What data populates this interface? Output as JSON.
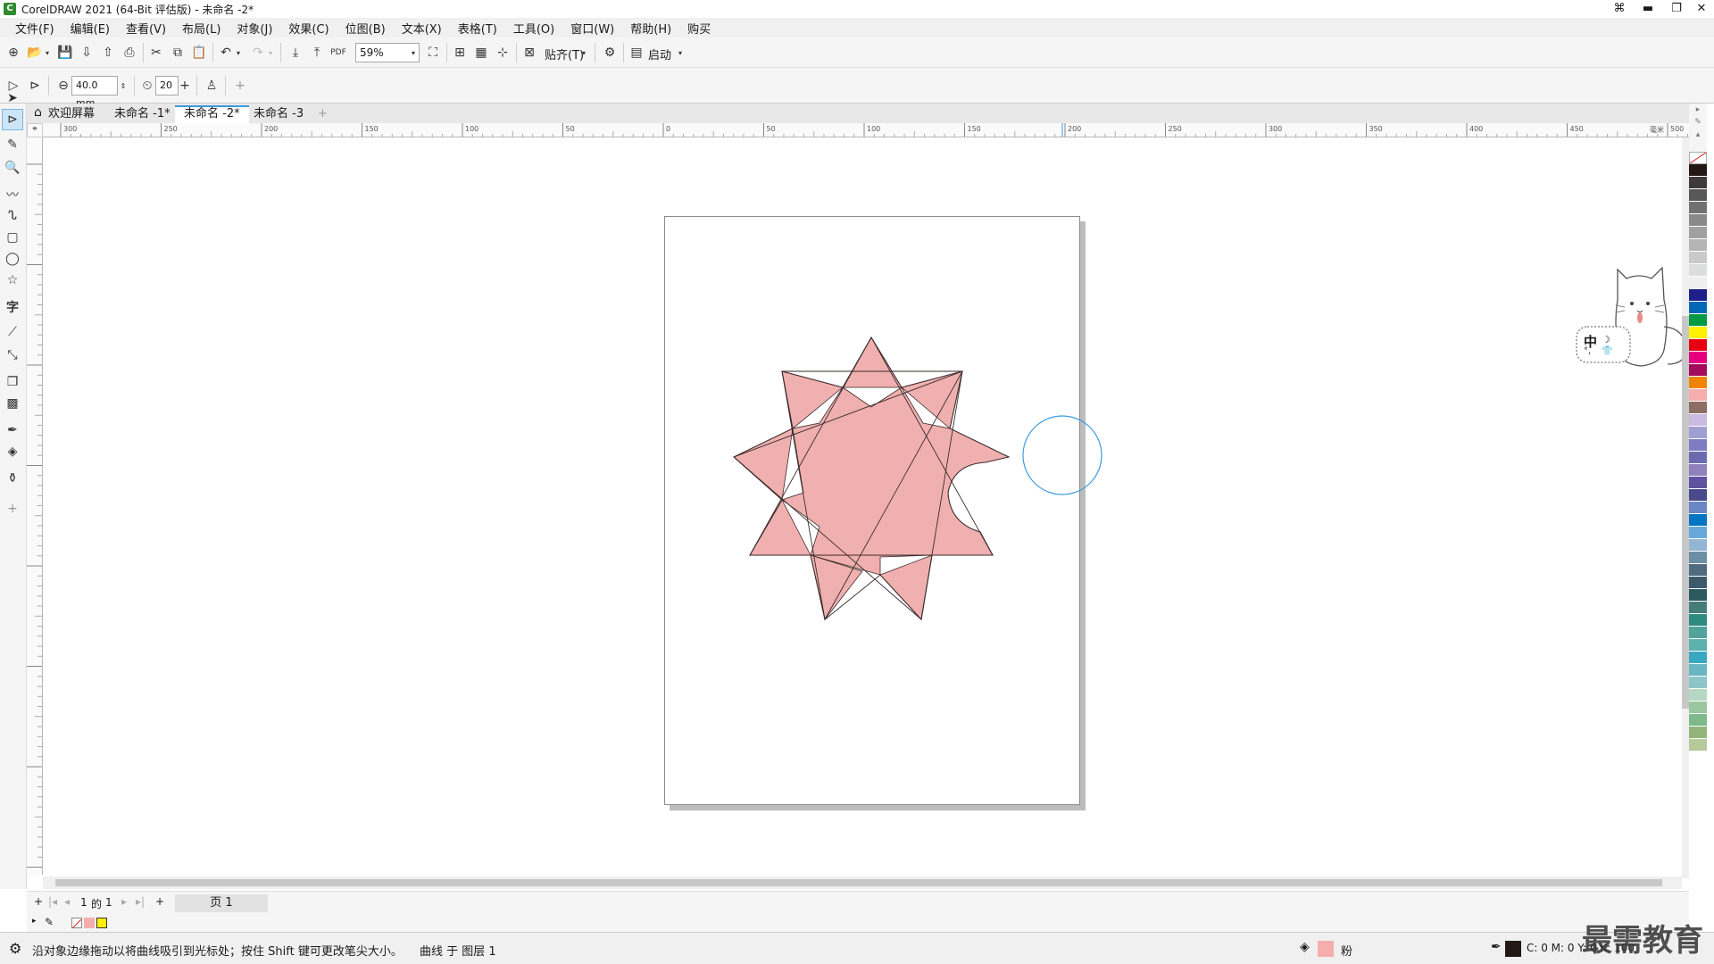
{
  "window": {
    "title": "CorelDRAW 2021 (64-Bit 评估版) - 未命名 -2*",
    "controls": [
      "▬",
      "❐",
      "✕"
    ]
  },
  "menu": [
    "文件(F)",
    "编辑(E)",
    "查看(V)",
    "布局(L)",
    "对象(J)",
    "效果(C)",
    "位图(B)",
    "文本(X)",
    "表格(T)",
    "工具(O)",
    "窗口(W)",
    "帮助(H)",
    "购买"
  ],
  "toolbar": {
    "zoom": "59%",
    "snap_label": "贴齐(T)",
    "launch_label": "启动"
  },
  "property_bar": {
    "nib_size": "40.0 mm",
    "pressure_value": "20"
  },
  "tabs": [
    {
      "label": "欢迎屏幕",
      "active": false
    },
    {
      "label": "未命名 -1*",
      "active": false
    },
    {
      "label": "未命名 -2*",
      "active": true
    },
    {
      "label": "未命名 -3",
      "active": false
    }
  ],
  "ruler": {
    "top_ticks": [
      "300",
      "250",
      "200",
      "150",
      "100",
      "50",
      "0",
      "50",
      "100",
      "150",
      "200",
      "250",
      "300",
      "350",
      "400",
      "450",
      "500"
    ],
    "unit": "毫米"
  },
  "pagenav": {
    "current": "1",
    "of_label": "的",
    "total": "1",
    "page_tab": "页 1"
  },
  "status": {
    "hint": "沿对象边缘拖动以将曲线吸引到光标处；按住 Shift 键可更改笔尖大小。",
    "object_info": "曲线 于 图层 1",
    "fill_name": "粉",
    "outline_values": "C: 0 M: 0 Y: 0 K: 100"
  },
  "colors": {
    "star_fill": "#f0b0b0",
    "accent": "#3c9be0"
  },
  "palette": [
    "#231815",
    "#3e3a39",
    "#595757",
    "#727171",
    "#898989",
    "#9fa0a0",
    "#b5b5b6",
    "#c9caca",
    "#dcdddd",
    "#efefef",
    "#1d2088",
    "#0068b7",
    "#009944",
    "#fff100",
    "#e60012",
    "#e4007f",
    "#a40b5d",
    "#f08300",
    "#f6adad",
    "#8c6e65",
    "#c9bce0",
    "#a09fd3",
    "#7f7dc1",
    "#6c6bb0",
    "#8f82bc",
    "#5f52a0",
    "#474a8b",
    "#6a86c3",
    "#0075c2",
    "#68a8db",
    "#94b6d2",
    "#6d8fa6",
    "#506b7d",
    "#3c5a6c",
    "#2c5a5e",
    "#467d7a",
    "#2e8b7f",
    "#52a39b",
    "#5db2ad",
    "#3aa8c1",
    "#68b7c2",
    "#8dc5c9",
    "#b7d7c5",
    "#9ac6a0",
    "#7db98b",
    "#92b57b",
    "#b5c99a"
  ],
  "watermark": "最需教育",
  "ime": "中"
}
